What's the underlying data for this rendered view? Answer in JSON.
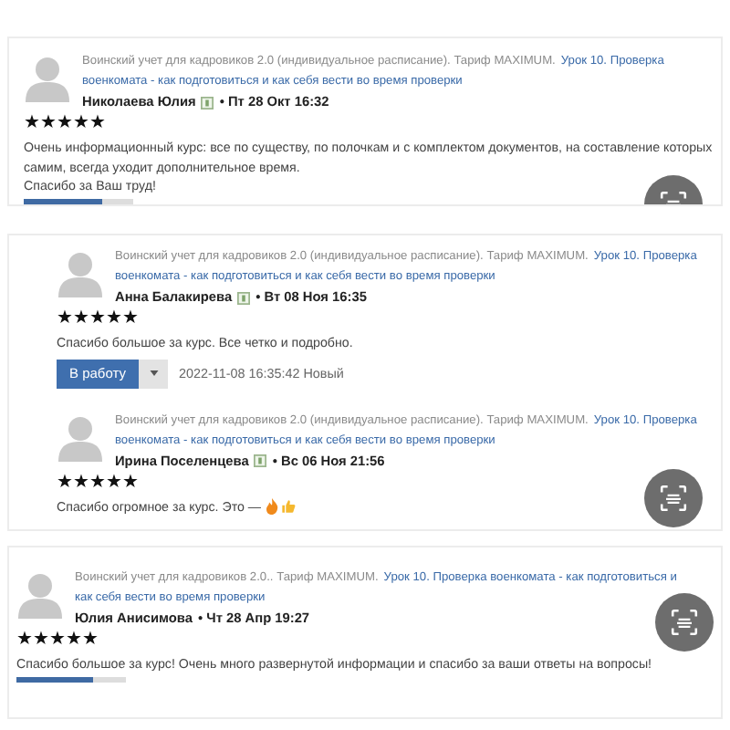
{
  "cards": [
    {
      "scan_button": true,
      "reviews": [
        {
          "course": "Воинский учет для кадровиков 2.0 (индивидуальное расписание). Тариф MAXIMUM.",
          "lesson": [
            "Урок 10. Проверка",
            "военкомата - как подготовиться и как себя вести во время проверки"
          ],
          "author": "Николаева Юлия",
          "badge": true,
          "date": "• Пт 28 Окт 16:32",
          "stars": 5,
          "text": [
            "Очень информационный курс: все по существу, по полочкам и с комплектом документов, на составление которых",
            "самим, всегда уходит дополнительное время.",
            "Спасибо за Ваш труд!"
          ],
          "progress": {
            "level": 0.72
          }
        }
      ]
    },
    {
      "scan_button": true,
      "reviews": [
        {
          "course": "Воинский учет для кадровиков 2.0 (индивидуальное расписание). Тариф MAXIMUM.",
          "lesson": [
            "Урок 10. Проверка",
            "военкомата - как подготовиться и как себя вести во время проверки"
          ],
          "author": "Анна Балакирева",
          "badge": true,
          "date": "• Вт 08 Ноя 16:35",
          "stars": 5,
          "text": [
            "Спасибо большое за курс. Все четко и подробно."
          ],
          "actions": {
            "button": "В работу",
            "status": "2022-11-08 16:35:42 Новый"
          }
        },
        {
          "course": "Воинский учет для кадровиков 2.0 (индивидуальное расписание). Тариф MAXIMUM.",
          "lesson": [
            "Урок 10. Проверка",
            "военкомата - как подготовиться и как себя вести во время проверки"
          ],
          "author": "Ирина Поселенцева",
          "badge": true,
          "date": "• Вс 06 Ноя 21:56",
          "stars": 5,
          "text": [
            "Спасибо огромное за курс. Это —"
          ],
          "emoji": true
        }
      ]
    },
    {
      "scan_button": true,
      "reviews": [
        {
          "course": "Воинский учет для кадровиков 2.0.. Тариф MAXIMUM.",
          "lesson": [
            "Урок 10. Проверка военкомата - как подготовиться и",
            "как себя вести во время проверки"
          ],
          "author": "Юлия Анисимова",
          "badge": false,
          "date": "• Чт 28 Апр 19:27",
          "stars": 5,
          "text": [
            "Спасибо большое за курс! Очень много развернутой информации и спасибо за ваши ответы на вопросы!"
          ],
          "progress": {
            "level": 0.7
          }
        }
      ]
    }
  ]
}
